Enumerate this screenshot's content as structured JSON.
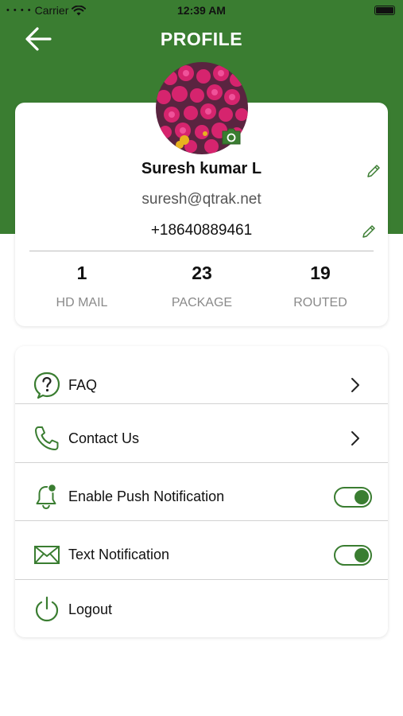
{
  "status_bar": {
    "carrier": "Carrier",
    "time": "12:39 AM"
  },
  "header": {
    "title": "PROFILE"
  },
  "profile": {
    "name": "Suresh kumar L",
    "email": "suresh@qtrak.net",
    "phone": "+18640889461"
  },
  "stats": [
    {
      "value": "1",
      "label": "HD MAIL"
    },
    {
      "value": "23",
      "label": "PACKAGE"
    },
    {
      "value": "19",
      "label": "ROUTED"
    }
  ],
  "menu": {
    "faq": "FAQ",
    "contact": "Contact Us",
    "push": "Enable Push Notification",
    "text": "Text Notification",
    "logout": "Logout"
  },
  "toggles": {
    "push_enabled": true,
    "text_enabled": true
  },
  "icons": [
    "back-arrow-icon",
    "camera-icon",
    "pencil-icon",
    "question-icon",
    "phone-icon",
    "bell-icon",
    "envelope-icon",
    "power-icon",
    "chevron-right-icon"
  ],
  "colors": {
    "brand_green": "#3a7d31",
    "text": "#111111",
    "muted": "#8a8a8a"
  }
}
